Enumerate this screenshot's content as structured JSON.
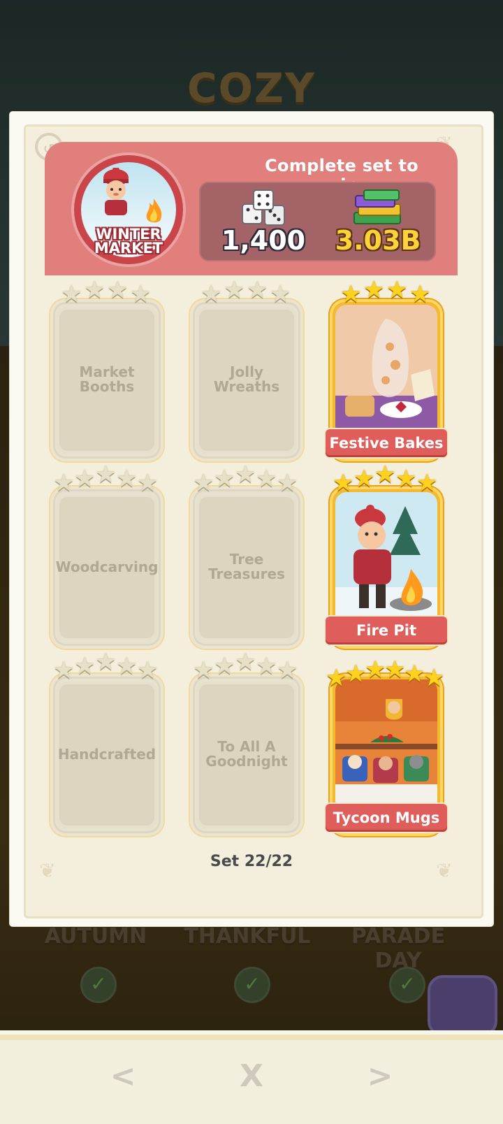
{
  "background": {
    "event_title": "COZY",
    "albums": [
      {
        "label": "AUTUMN"
      },
      {
        "label": "THANKFUL"
      },
      {
        "label": "PARADE DAY"
      }
    ]
  },
  "set": {
    "name": "WINTER MARKET",
    "reward_title": "Complete set to win",
    "rewards": {
      "dice": "1,400",
      "cash": "3.03B"
    },
    "progress_text": "Set 22/22"
  },
  "cards": [
    {
      "name": "Market Booths",
      "stars": 4,
      "owned": false,
      "label_lines": [
        "Market",
        "Booths"
      ]
    },
    {
      "name": "Jolly Wreaths",
      "stars": 4,
      "owned": false,
      "label_lines": [
        "Jolly",
        "Wreaths"
      ]
    },
    {
      "name": "Festive Bakes",
      "stars": 4,
      "owned": true
    },
    {
      "name": "Woodcarving",
      "stars": 5,
      "owned": false,
      "label_lines": [
        "Woodcarving"
      ]
    },
    {
      "name": "Tree Treasures",
      "stars": 5,
      "owned": false,
      "label_lines": [
        "Tree",
        "Treasures"
      ]
    },
    {
      "name": "Fire Pit",
      "stars": 5,
      "owned": true
    },
    {
      "name": "Handcrafted",
      "stars": 5,
      "owned": false,
      "label_lines": [
        "Handcrafted"
      ]
    },
    {
      "name": "To All A Goodnight",
      "stars": 5,
      "owned": false,
      "label_lines": [
        "To All A",
        "Goodnight"
      ]
    },
    {
      "name": "Tycoon Mugs",
      "stars": 6,
      "owned": true
    }
  ],
  "nav": {
    "prev": "<",
    "close": "X",
    "next": ">"
  },
  "colors": {
    "banner": "#e17f7c",
    "reward_panel": "#a46467",
    "card_label": "#df5e5b",
    "gold_star": "#ffd31d",
    "grey_star": "#e7e0c8"
  },
  "icons": [
    "history-icon",
    "dice-icon",
    "cash-stack-icon",
    "star-icon",
    "close-icon",
    "chevron-left-icon",
    "chevron-right-icon"
  ]
}
